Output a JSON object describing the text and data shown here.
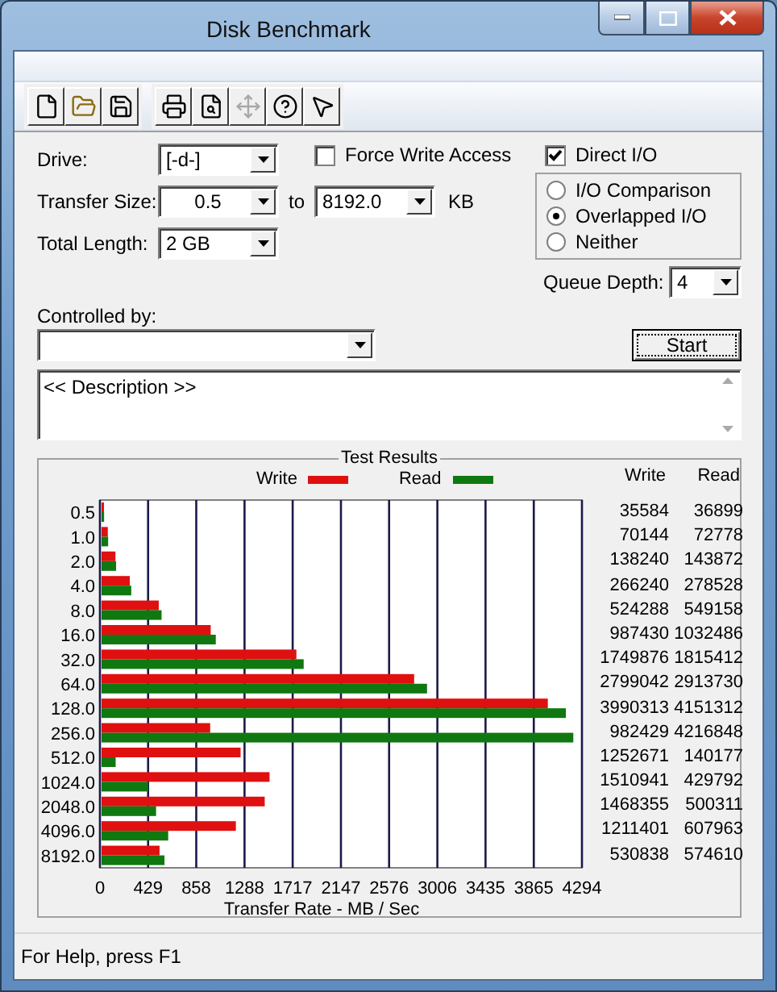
{
  "window": {
    "title": "Disk Benchmark"
  },
  "toolbar": [
    {
      "kind": "new",
      "disabled": false
    },
    {
      "kind": "open",
      "disabled": false
    },
    {
      "kind": "save",
      "disabled": false
    },
    {
      "kind": "print",
      "disabled": false
    },
    {
      "kind": "preview",
      "disabled": false
    },
    {
      "kind": "move",
      "disabled": true
    },
    {
      "kind": "help",
      "disabled": false
    },
    {
      "kind": "context-help",
      "disabled": false
    }
  ],
  "form": {
    "drive": {
      "label": "Drive:",
      "value": "[-d-]"
    },
    "force_write": {
      "label": "Force Write Access",
      "checked": false
    },
    "transfer_size": {
      "label": "Transfer Size:",
      "from": "0.5",
      "to_label": "to",
      "to": "8192.0",
      "unit": "KB"
    },
    "total_length": {
      "label": "Total Length:",
      "value": "2 GB"
    },
    "direct_io": {
      "label": "Direct I/O",
      "checked": true
    },
    "io_modes": [
      {
        "label": "I/O Comparison",
        "selected": false
      },
      {
        "label": "Overlapped I/O",
        "selected": true
      },
      {
        "label": "Neither",
        "selected": false
      }
    ],
    "queue_depth": {
      "label": "Queue Depth:",
      "value": "4"
    },
    "controlled_by": {
      "label": "Controlled by:"
    },
    "start_button": "Start",
    "description": "<< Description >>"
  },
  "test_results": {
    "title": "Test Results",
    "column_headers": [
      "Write",
      "Read"
    ],
    "rows": [
      {
        "write": "35584",
        "read": "36899"
      },
      {
        "write": "70144",
        "read": "72778"
      },
      {
        "write": "138240",
        "read": "143872"
      },
      {
        "write": "266240",
        "read": "278528"
      },
      {
        "write": "524288",
        "read": "549158"
      },
      {
        "write": "987430",
        "read": "1032486"
      },
      {
        "write": "1749876",
        "read": "1815412"
      },
      {
        "write": "2799042",
        "read": "2913730"
      },
      {
        "write": "3990313",
        "read": "4151312"
      },
      {
        "write": "982429",
        "read": "4216848"
      },
      {
        "write": "1252671",
        "read": "140177"
      },
      {
        "write": "1510941",
        "read": "429792"
      },
      {
        "write": "1468355",
        "read": "500311"
      },
      {
        "write": "1211401",
        "read": "607963"
      },
      {
        "write": "530838",
        "read": "574610"
      }
    ],
    "chart_data": {
      "type": "bar",
      "orientation": "horizontal",
      "xlabel": "Transfer Rate - MB / Sec",
      "categories": [
        "0.5",
        "1.0",
        "2.0",
        "4.0",
        "8.0",
        "16.0",
        "32.0",
        "64.0",
        "128.0",
        "256.0",
        "512.0",
        "1024.0",
        "2048.0",
        "4096.0",
        "8192.0"
      ],
      "series": [
        {
          "name": "Write",
          "color": "#e01010",
          "values": [
            36,
            70,
            138,
            266,
            524,
            987,
            1750,
            2799,
            3990,
            982,
            1253,
            1511,
            1468,
            1211,
            531
          ]
        },
        {
          "name": "Read",
          "color": "#107810",
          "values": [
            37,
            73,
            144,
            279,
            549,
            1032,
            1815,
            2914,
            4151,
            4217,
            140,
            430,
            500,
            608,
            575
          ]
        }
      ],
      "xlim": [
        0,
        4294
      ],
      "grid": true,
      "xticks": [
        0,
        429,
        858,
        1288,
        1717,
        2147,
        2576,
        3006,
        3435,
        3865,
        4294
      ]
    }
  },
  "status_bar": "For Help, press F1"
}
